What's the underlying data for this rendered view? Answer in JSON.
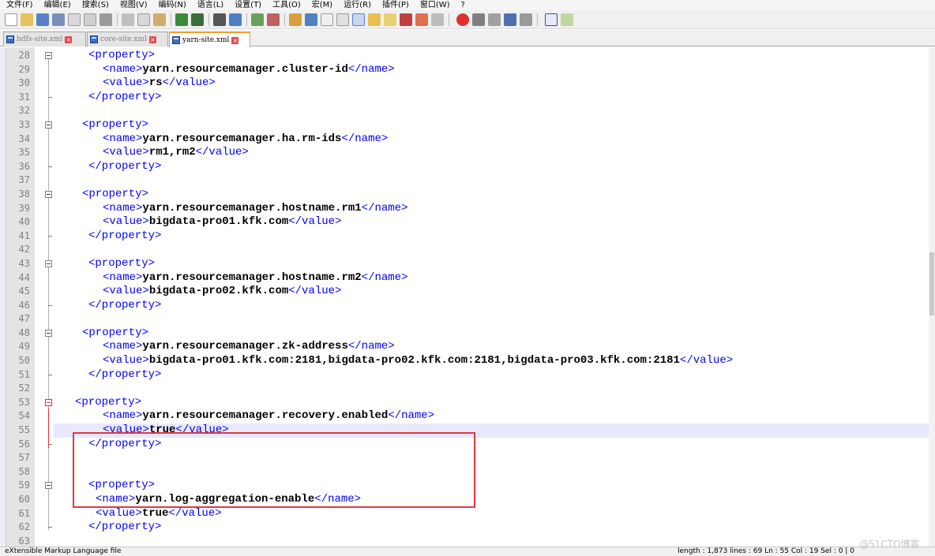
{
  "menu": [
    "文件(F)",
    "编辑(E)",
    "搜索(S)",
    "视图(V)",
    "编码(N)",
    "语言(L)",
    "设置(T)",
    "工具(O)",
    "宏(M)",
    "运行(R)",
    "插件(P)",
    "窗口(W)",
    "?"
  ],
  "tabs": [
    {
      "label": "hdfs-site.xml",
      "active": false
    },
    {
      "label": "core-site.xml",
      "active": false
    },
    {
      "label": "yarn-site.xml",
      "active": true
    }
  ],
  "editor": {
    "current_line": "55",
    "lines": [
      {
        "n": "28",
        "tag1": "<property>"
      },
      {
        "n": "29",
        "tag1": "<name>",
        "val": "yarn.resourcemanager.cluster-id",
        "tag2": "</name>"
      },
      {
        "n": "30",
        "tag1": "<value>",
        "val": "rs",
        "tag2": "</value>"
      },
      {
        "n": "31",
        "tag1": "</property>"
      },
      {
        "n": "32"
      },
      {
        "n": "33",
        "tag1": "<property>"
      },
      {
        "n": "34",
        "tag1": "<name>",
        "val": "yarn.resourcemanager.ha.rm-ids",
        "tag2": "</name>"
      },
      {
        "n": "35",
        "tag1": "<value>",
        "val": "rm1,rm2",
        "tag2": "</value>"
      },
      {
        "n": "36",
        "tag1": "</property>"
      },
      {
        "n": "37"
      },
      {
        "n": "38",
        "tag1": "<property>"
      },
      {
        "n": "39",
        "tag1": "<name>",
        "val": "yarn.resourcemanager.hostname.rm1",
        "tag2": "</name>"
      },
      {
        "n": "40",
        "tag1": "<value>",
        "val": "bigdata-pro01.kfk.com",
        "tag2": "</value>"
      },
      {
        "n": "41",
        "tag1": "</property>"
      },
      {
        "n": "42"
      },
      {
        "n": "43",
        "tag1": "<property>"
      },
      {
        "n": "44",
        "tag1": "<name>",
        "val": "yarn.resourcemanager.hostname.rm2",
        "tag2": "</name>"
      },
      {
        "n": "45",
        "tag1": "<value>",
        "val": "bigdata-pro02.kfk.com",
        "tag2": "</value>"
      },
      {
        "n": "46",
        "tag1": "</property>"
      },
      {
        "n": "47"
      },
      {
        "n": "48",
        "tag1": "<property>"
      },
      {
        "n": "49",
        "tag1": "<name>",
        "val": "yarn.resourcemanager.zk-address",
        "tag2": "</name>"
      },
      {
        "n": "50",
        "tag1": "<value>",
        "val": "bigdata-pro01.kfk.com:2181,bigdata-pro02.kfk.com:2181,bigdata-pro03.kfk.com:2181",
        "tag2": "</value>"
      },
      {
        "n": "51",
        "tag1": "</property>"
      },
      {
        "n": "52"
      },
      {
        "n": "53",
        "tag1": "<property>"
      },
      {
        "n": "54",
        "tag1": "<name>",
        "val": "yarn.resourcemanager.recovery.enabled",
        "tag2": "</name>"
      },
      {
        "n": "55",
        "tag1": "<value>",
        "val": "true",
        "tag2": "</value>"
      },
      {
        "n": "56",
        "tag1": "</property>"
      },
      {
        "n": "57"
      },
      {
        "n": "58"
      },
      {
        "n": "59",
        "tag1": "<property>"
      },
      {
        "n": "60",
        "tag1": "<name>",
        "val": "yarn.log-aggregation-enable",
        "tag2": "</name>"
      },
      {
        "n": "61",
        "tag1": "<value>",
        "val": "true",
        "tag2": "</value>"
      },
      {
        "n": "62",
        "tag1": "</property>"
      },
      {
        "n": "63"
      }
    ]
  },
  "statusbar": {
    "left": "eXtensible Markup Language file",
    "right": "length : 1,873    lines : 69    Ln : 55    Col : 19    Sel : 0 | 0"
  },
  "watermark": "@51CTO博客",
  "colors": {
    "tag": "#0000ff",
    "highlight_box": "#e0393e",
    "current_line": "#e8e8ff"
  }
}
